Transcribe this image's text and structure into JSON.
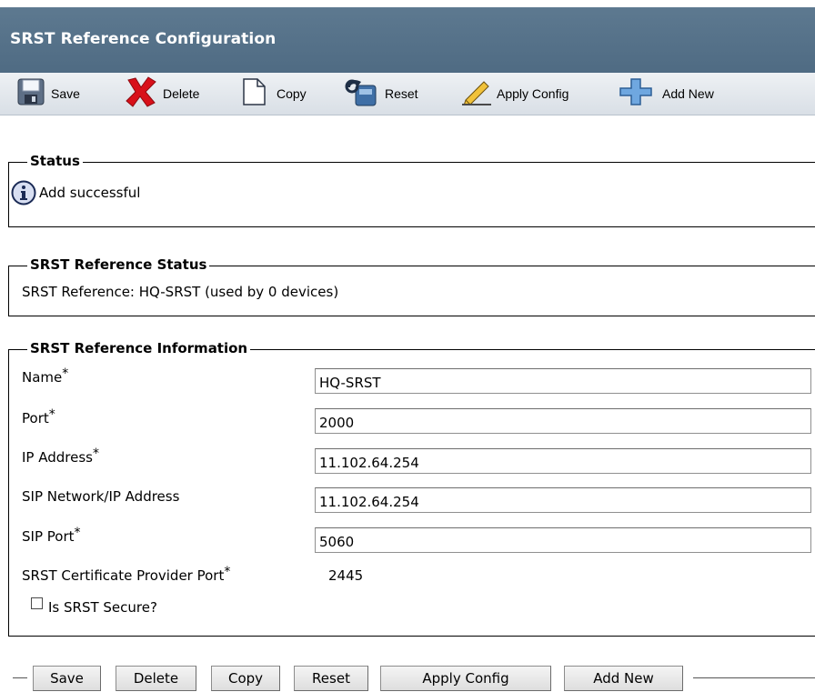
{
  "page_title": "SRST Reference Configuration",
  "toolbar": {
    "save": "Save",
    "delete": "Delete",
    "copy": "Copy",
    "reset": "Reset",
    "apply_config": "Apply Config",
    "add_new": "Add New"
  },
  "status": {
    "legend": "Status",
    "icon": "info-icon",
    "message": "Add successful"
  },
  "reference_status": {
    "legend": "SRST Reference Status",
    "text": "SRST Reference: HQ-SRST (used by 0 devices)"
  },
  "reference_info": {
    "legend": "SRST Reference Information",
    "name_label": "Name",
    "name_value": "HQ-SRST",
    "port_label": "Port",
    "port_value": "2000",
    "ip_label": "IP Address",
    "ip_value": "11.102.64.254",
    "sip_network_label": "SIP Network/IP Address",
    "sip_network_value": "11.102.64.254",
    "sip_port_label": "SIP Port",
    "sip_port_value": "5060",
    "cert_port_label": "SRST Certificate Provider Port",
    "cert_port_value": "2445",
    "secure_label": "Is SRST Secure?",
    "secure_checked": false,
    "required_mark": "*"
  },
  "bottom_buttons": {
    "save": "Save",
    "delete": "Delete",
    "copy": "Copy",
    "reset": "Reset",
    "apply_config": "Apply Config",
    "add_new": "Add New"
  }
}
